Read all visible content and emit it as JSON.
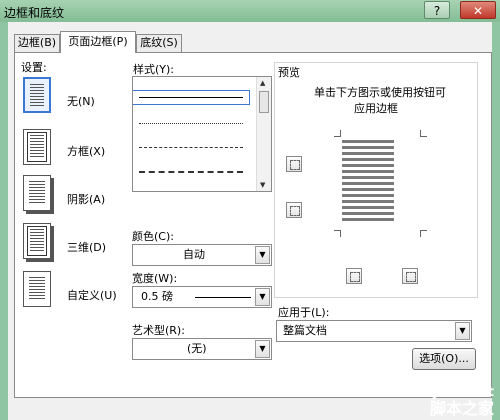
{
  "window": {
    "title": "边框和底纹",
    "help_label": "?",
    "close_label": "✕"
  },
  "tabs": [
    {
      "label": "边框(B)",
      "active": false
    },
    {
      "label": "页面边框(P)",
      "active": true
    },
    {
      "label": "底纹(S)",
      "active": false
    }
  ],
  "settings": {
    "heading": "设置:",
    "items": [
      {
        "label": "无(N)",
        "icon": "page-no-border-icon",
        "selected": true
      },
      {
        "label": "方框(X)",
        "icon": "page-box-border-icon",
        "selected": false
      },
      {
        "label": "阴影(A)",
        "icon": "page-shadow-border-icon",
        "selected": false
      },
      {
        "label": "三维(D)",
        "icon": "page-3d-border-icon",
        "selected": false
      },
      {
        "label": "自定义(U)",
        "icon": "page-custom-border-icon",
        "selected": false
      }
    ]
  },
  "style": {
    "label": "样式(Y):",
    "line_styles": [
      "solid",
      "dotted-fine",
      "dashed-small",
      "dashed",
      "dash-dot"
    ],
    "selected_index": 0
  },
  "color": {
    "label": "颜色(C):",
    "value": "自动"
  },
  "width": {
    "label": "宽度(W):",
    "value": "0.5 磅"
  },
  "art": {
    "label": "艺术型(R):",
    "value": "(无)"
  },
  "preview": {
    "heading": "预览",
    "instruction_line1": "单击下方图示或使用按钮可",
    "instruction_line2": "应用边框"
  },
  "apply_to": {
    "label": "应用于(L):",
    "value": "整篇文档"
  },
  "buttons": {
    "options": "选项(O)..."
  },
  "watermark": {
    "line1": "jb51.net",
    "line2": "脚本之家"
  },
  "colors": {
    "title_bar": "#8fc5a2",
    "dialog_bg": "#f0f0f0",
    "selection": "#3b78d6"
  }
}
